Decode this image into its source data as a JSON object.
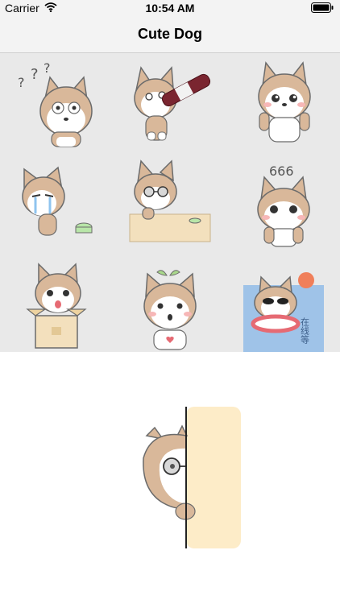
{
  "status_bar": {
    "carrier": "Carrier",
    "time": "10:54 AM",
    "wifi_icon": "wifi-icon",
    "battery_icon": "battery-icon"
  },
  "nav": {
    "title": "Cute Dog"
  },
  "stickers": [
    {
      "name": "confused",
      "marks": "?  ?  ?"
    },
    {
      "name": "drinking-cola",
      "marks": ""
    },
    {
      "name": "sparkle-eyes",
      "marks": ""
    },
    {
      "name": "crying",
      "marks": ""
    },
    {
      "name": "sunglasses-desk",
      "marks": ""
    },
    {
      "name": "666",
      "marks": "666"
    },
    {
      "name": "in-box",
      "marks": ""
    },
    {
      "name": "surprised-sprout",
      "marks": ""
    },
    {
      "name": "pool-ring",
      "marks": "在线等"
    }
  ],
  "preview": {
    "name": "peeking-dog"
  },
  "colors": {
    "grid_bg": "#e9e9e9",
    "dog_tan": "#d9b89a",
    "dog_outline": "#6b6b6b",
    "blush": "#f7b7b7",
    "panel": "#fdecc8",
    "water": "#9fc3e8",
    "sun": "#f07f5a"
  }
}
